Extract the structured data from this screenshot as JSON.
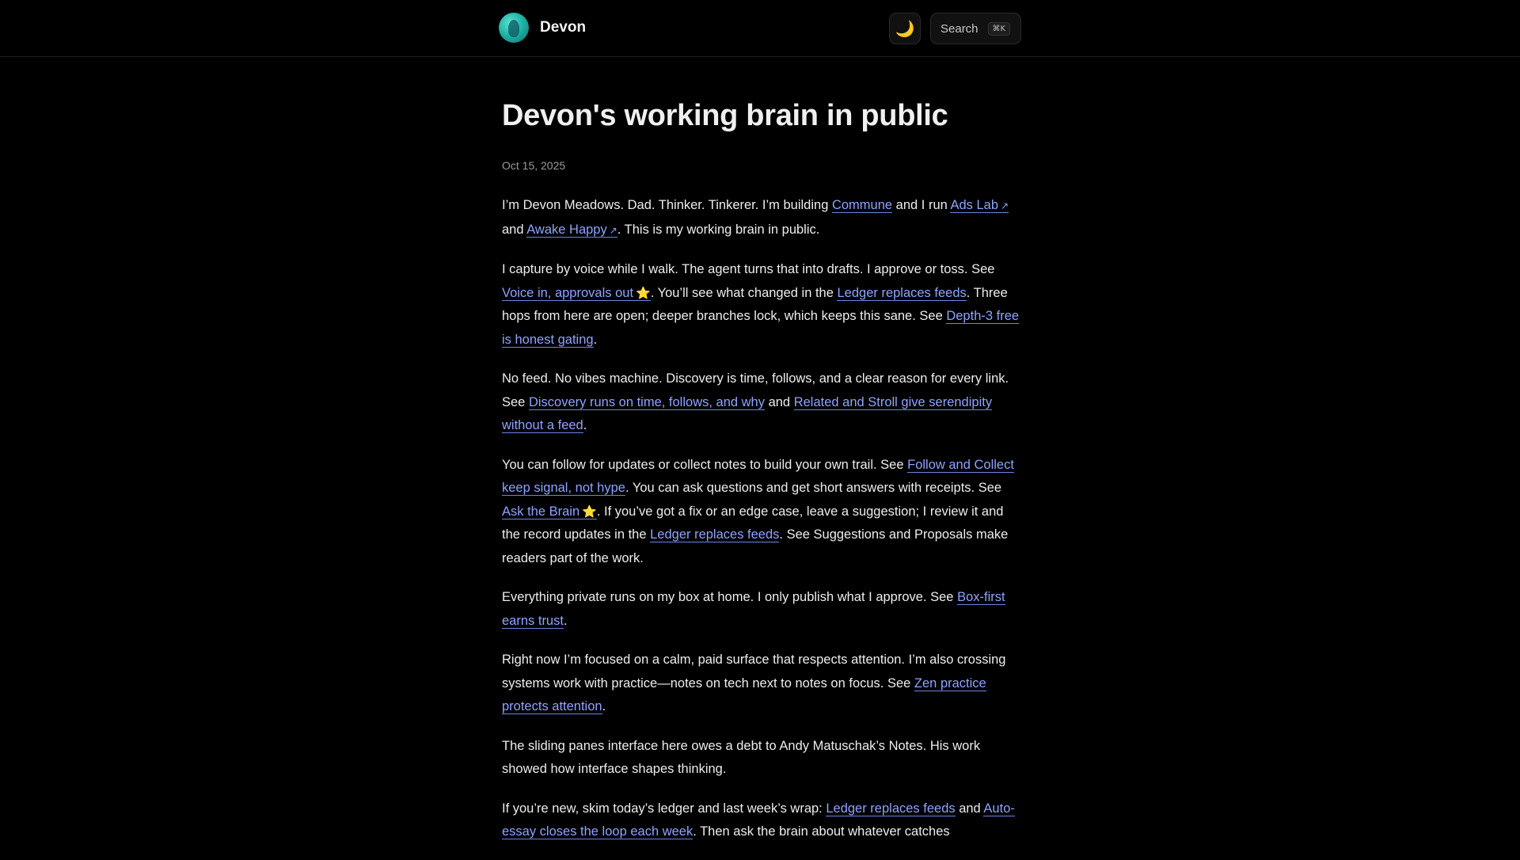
{
  "header": {
    "site_name": "Devon",
    "theme_icon": "🌙",
    "search_label": "Search",
    "search_shortcut": "⌘K"
  },
  "article": {
    "title": "Devon's working brain in public",
    "date": "Oct 15, 2025",
    "p1": {
      "t1": "I’m Devon Meadows. Dad. Thinker. Tinkerer. I’m building ",
      "l1": "Commune",
      "t2": " and I run ",
      "l2": "Ads Lab",
      "ext": "↗",
      "t3": " and ",
      "l3": "Awake Happy",
      "t4": ". This is my working brain in public."
    },
    "p2": {
      "t1": "I capture by voice while I walk. The agent turns that into drafts. I approve or toss. See ",
      "l1": "Voice in, approvals out",
      "star": "⭐",
      "t2": ". You’ll see what changed in the ",
      "l2": "Ledger replaces feeds",
      "t3": ". Three hops from here are open; deeper branches lock, which keeps this sane. See ",
      "l3": "Depth-3 free is honest gating",
      "t4": "."
    },
    "p3": {
      "t1": "No feed. No vibes machine. Discovery is time, follows, and a clear reason for every link. See ",
      "l1": "Discovery runs on time, follows, and why",
      "t2": " and ",
      "l2": "Related and Stroll give serendipity without a feed",
      "t3": "."
    },
    "p4": {
      "t1": "You can follow for updates or collect notes to build your own trail. See ",
      "l1": "Follow and Collect keep signal, not hype",
      "t2": ". You can ask questions and get short answers with receipts. See ",
      "l2": "Ask the Brain",
      "star": "⭐",
      "t3": ". If you’ve got a fix or an edge case, leave a suggestion; I review it and the record updates in the ",
      "l3": "Ledger replaces feeds",
      "t4": ". See Suggestions and Proposals make readers part of the work."
    },
    "p5": {
      "t1": "Everything private runs on my box at home. I only publish what I approve. See ",
      "l1": "Box-first earns trust",
      "t2": "."
    },
    "p6": {
      "t1": "Right now I’m focused on a calm, paid surface that respects attention. I’m also crossing systems work with practice—notes on tech next to notes on focus. See ",
      "l1": "Zen practice protects attention",
      "t2": "."
    },
    "p7": {
      "t1": "The sliding panes interface here owes a debt to Andy Matuschak’s Notes. His work showed how interface shapes thinking."
    },
    "p8": {
      "t1": "If you’re new, skim today’s ledger and last week’s wrap: ",
      "l1": "Ledger replaces feeds",
      "t2": " and ",
      "l2": "Auto-essay closes the loop each week",
      "t3": ". Then ask the brain about whatever catches"
    }
  }
}
